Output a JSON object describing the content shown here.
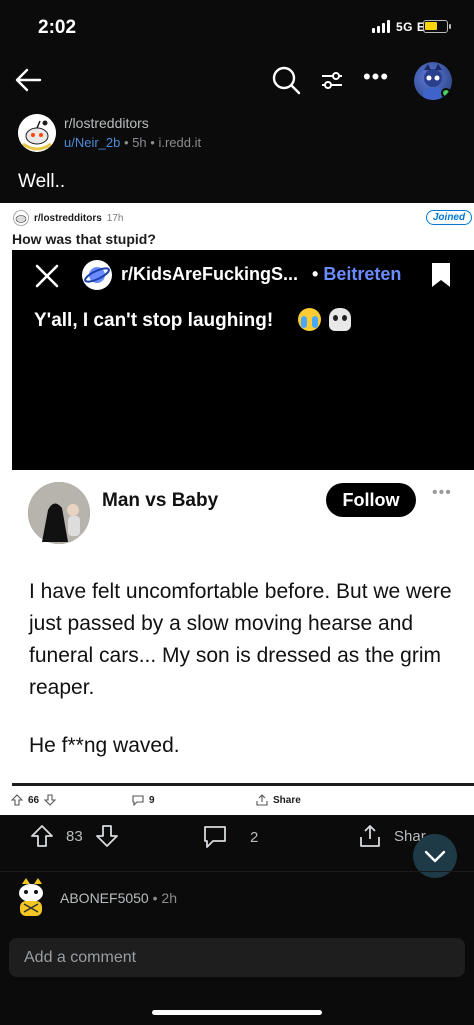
{
  "status_bar": {
    "time": "2:02",
    "network": "5G E",
    "battery_color": "#ffd60a"
  },
  "nav": {
    "back_icon": "arrow-left-icon",
    "search_icon": "search-icon",
    "sort_icon": "sort-icon",
    "more_icon": "more-horizontal-icon"
  },
  "post": {
    "subreddit": "r/lostredditors",
    "author": "u/Neir_2b",
    "meta_sep": "•",
    "age": "5h",
    "domain": "i.redd.it",
    "title": "Well.."
  },
  "embedded": {
    "subreddit": "r/lostredditors",
    "age": "17h",
    "joined_label": "Joined",
    "title": "How was that stupid?",
    "inner": {
      "subreddit": "r/KidsAreFuckingS...",
      "dot": "•",
      "join_label": "Beitreten",
      "text": "Y'all, I can't stop laughing!"
    },
    "tweet": {
      "name": "Man vs Baby",
      "follow_label": "Follow",
      "body": "I have felt uncomfortable before. But we were just passed by a slow moving hearse and funeral cars... My son is dressed as the grim reaper.",
      "body2": "He f**ng waved."
    },
    "votes": "66",
    "comments": "9",
    "share_label": "Share"
  },
  "actions": {
    "votes": "83",
    "comments": "2",
    "share_label": "Shar"
  },
  "comment_preview": {
    "user": "ABONEF5050",
    "dot": "•",
    "age": "2h"
  },
  "composer": {
    "placeholder": "Add a comment"
  },
  "colors": {
    "accent_blue": "#4f8bd6",
    "joined_blue": "#0079d3",
    "beitreten_blue": "#6b8cff",
    "fab_bg": "#1f3a47"
  }
}
